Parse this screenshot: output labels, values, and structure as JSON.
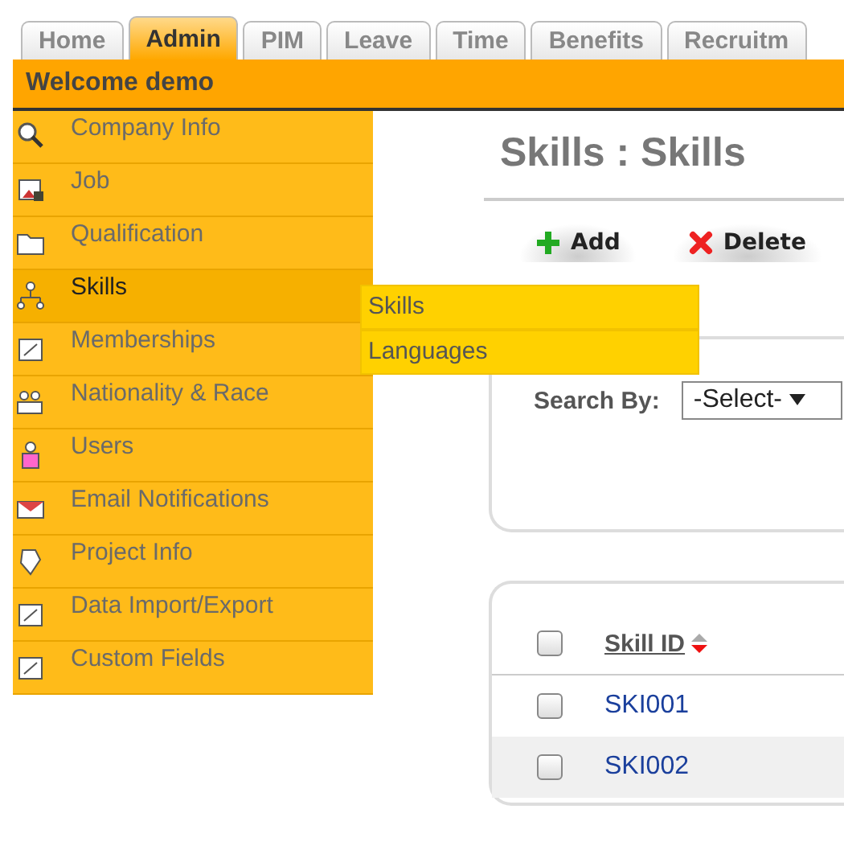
{
  "tabs": [
    {
      "label": "Home",
      "selected": false
    },
    {
      "label": "Admin",
      "selected": true
    },
    {
      "label": "PIM",
      "selected": false
    },
    {
      "label": "Leave",
      "selected": false
    },
    {
      "label": "Time",
      "selected": false
    },
    {
      "label": "Benefits",
      "selected": false
    },
    {
      "label": "Recruitm",
      "selected": false
    }
  ],
  "welcome": "Welcome demo",
  "menu": [
    {
      "label": "Company Info",
      "selected": false
    },
    {
      "label": "Job",
      "selected": false
    },
    {
      "label": "Qualification",
      "selected": false
    },
    {
      "label": "Skills",
      "selected": true
    },
    {
      "label": "Memberships",
      "selected": false
    },
    {
      "label": "Nationality & Race",
      "selected": false
    },
    {
      "label": "Users",
      "selected": false
    },
    {
      "label": "Email Notifications",
      "selected": false
    },
    {
      "label": "Project Info",
      "selected": false
    },
    {
      "label": "Data Import/Export",
      "selected": false
    },
    {
      "label": "Custom Fields",
      "selected": false
    }
  ],
  "submenu": [
    "Skills",
    "Languages"
  ],
  "page_title": "Skills : Skills",
  "actions": [
    {
      "kind": "add",
      "label": "Add"
    },
    {
      "kind": "delete",
      "label": "Delete"
    }
  ],
  "search": {
    "label": "Search By:",
    "value": "-Select-"
  },
  "table": {
    "header": "Skill ID",
    "all_checked": false,
    "rows": [
      {
        "id": "SKI001",
        "checked": false
      },
      {
        "id": "SKI002",
        "checked": false
      }
    ]
  }
}
